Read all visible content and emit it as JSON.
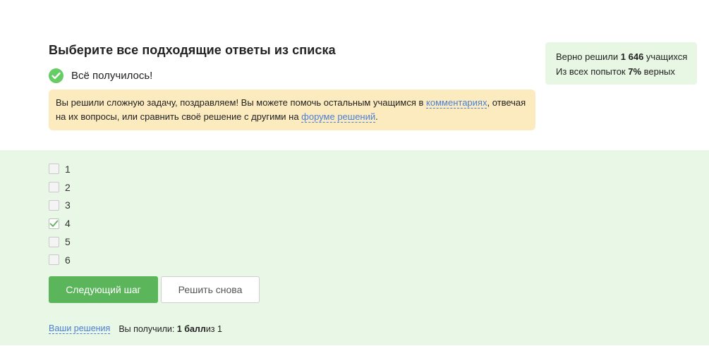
{
  "question": {
    "title": "Выберите все подходящие ответы из списка"
  },
  "result": {
    "text": "Всё получилось!",
    "icon": "check-circle-icon",
    "color": "#66cc66"
  },
  "notice": {
    "part1": "Вы решили сложную задачу, поздравляем! Вы можете помочь остальным учащимся в ",
    "link_comments": "комментариях",
    "part2": ", отвечая на их вопросы, или сравнить своё решение с другими на ",
    "link_forum": "форуме решений",
    "part3": ".",
    "background": "#fdebc0"
  },
  "stats": {
    "line1_prefix": "Верно решили ",
    "line1_value": "1 646",
    "line1_suffix": " учащихся",
    "line2_prefix": "Из всех попыток ",
    "line2_value": "7%",
    "line2_suffix": " верных"
  },
  "options": [
    {
      "label": "1",
      "checked": false
    },
    {
      "label": "2",
      "checked": false
    },
    {
      "label": "3",
      "checked": false
    },
    {
      "label": "4",
      "checked": true
    },
    {
      "label": "5",
      "checked": false
    },
    {
      "label": "6",
      "checked": false
    }
  ],
  "buttons": {
    "next": "Следующий шаг",
    "retry": "Решить снова"
  },
  "footer": {
    "solutions_link": "Ваши решения",
    "score_prefix": "Вы получили: ",
    "score_value": "1 балл",
    "score_suffix": " из 1"
  },
  "colors": {
    "accent_green": "#5bb55b",
    "answer_bg": "#e8f7e6",
    "link": "#4a7fd4"
  }
}
